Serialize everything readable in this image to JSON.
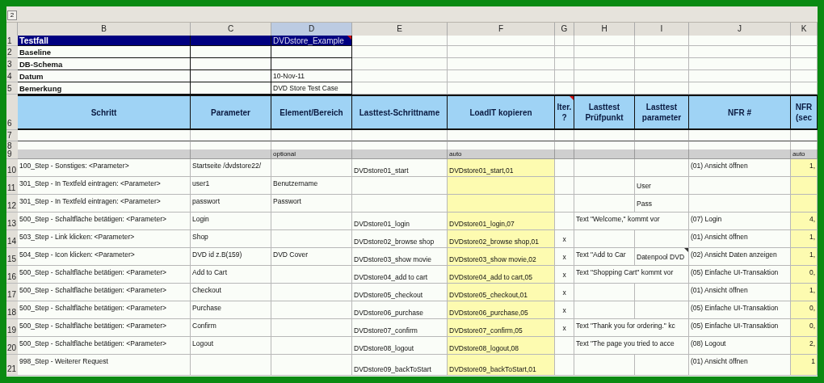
{
  "outline": {
    "level_button": "2"
  },
  "columns": [
    {
      "letter": "B",
      "selected": false
    },
    {
      "letter": "C",
      "selected": false
    },
    {
      "letter": "D",
      "selected": true
    },
    {
      "letter": "E",
      "selected": false
    },
    {
      "letter": "F",
      "selected": false
    },
    {
      "letter": "G",
      "selected": false
    },
    {
      "letter": "H",
      "selected": false
    },
    {
      "letter": "I",
      "selected": false
    },
    {
      "letter": "J",
      "selected": false
    },
    {
      "letter": "K",
      "selected": false
    }
  ],
  "meta": [
    {
      "row": "1",
      "kind": "title",
      "label": "Testfall",
      "value": "DVDstore_Example",
      "comment": true
    },
    {
      "row": "2",
      "kind": "field",
      "label": "Baseline",
      "comment": false
    },
    {
      "row": "3",
      "kind": "field",
      "label": "DB-Schema",
      "comment": false
    },
    {
      "row": "4",
      "kind": "field",
      "label": "Datum",
      "value": "10-Nov-11",
      "comment": false
    },
    {
      "row": "5",
      "kind": "field",
      "label": "Bemerkung",
      "value": "DVD Store Test Case",
      "comment": false
    }
  ],
  "header": {
    "row": "6",
    "labels": [
      {
        "text": "Schritt",
        "comment": false
      },
      {
        "text": "Parameter",
        "comment": false
      },
      {
        "text": "Element/Bereich",
        "comment": false
      },
      {
        "text": "Lasttest-Schrittname",
        "comment": false
      },
      {
        "text": "LoadIT kopieren",
        "comment": false
      },
      {
        "text": "Iter. ?",
        "comment": true
      },
      {
        "text": "Lasttest Prüfpunkt",
        "comment": false
      },
      {
        "text": "Lasttest parameter",
        "comment": false
      },
      {
        "text": "NFR #",
        "comment": false
      },
      {
        "text": "NFR (sec",
        "comment": false
      }
    ]
  },
  "blank_rows": [
    "7",
    "8"
  ],
  "hint_row": {
    "row": "9",
    "element": "optional",
    "loadit": "auto",
    "sec": "auto"
  },
  "steps": [
    {
      "row": "10",
      "schritt": "100_Step - Sonstiges: <Parameter>",
      "parameter": "Startseite /dvdstore22/",
      "name": "DVDstore01_start",
      "loadit": "DVDstore01_start,01",
      "nfr": "(01) Ansicht öffnen",
      "sec": "1,",
      "param_comment": false
    },
    {
      "row": "11",
      "schritt": "301_Step - In Textfeld eintragen: <Parameter>",
      "parameter": "user1",
      "element": "Benutzername",
      "param": "User",
      "param_comment": false
    },
    {
      "row": "12",
      "schritt": "301_Step - In Textfeld eintragen: <Parameter>",
      "parameter": "passwort",
      "element": "Passwort",
      "param": "Pass",
      "param_comment": false
    },
    {
      "row": "13",
      "schritt": "500_Step - Schaltfläche betätigen: <Parameter>",
      "parameter": "Login",
      "name": "DVDstore01_login",
      "loadit": "DVDstore01_login,07",
      "pruefpunkt": "Text \"Welcome,\" kommt vor",
      "nfr": "(07) Login",
      "sec": "4,",
      "param_comment": false
    },
    {
      "row": "14",
      "schritt": "503_Step - Link klicken: <Parameter>",
      "parameter": "Shop",
      "name": "DVDstore02_browse shop",
      "loadit": "DVDstore02_browse shop,01",
      "iter": "x",
      "nfr": "(01) Ansicht öffnen",
      "sec": "1,",
      "param_comment": false
    },
    {
      "row": "15",
      "schritt": "504_Step - Icon klicken: <Parameter>",
      "parameter": "DVD id z.B(159)",
      "element": "DVD Cover",
      "name": "DVDstore03_show movie",
      "loadit": "DVDstore03_show movie,02",
      "iter": "x",
      "pruefpunkt": "Text \"Add to Car",
      "param": "Datenpool DVD",
      "nfr": "(02) Ansicht Daten anzeigen",
      "sec": "1,",
      "param_comment": true
    },
    {
      "row": "16",
      "schritt": "500_Step - Schaltfläche betätigen: <Parameter>",
      "parameter": "Add to Cart",
      "name": "DVDstore04_add to cart",
      "loadit": "DVDstore04_add to cart,05",
      "iter": "x",
      "pruefpunkt": "Text \"Shopping Cart\" kommt vor",
      "nfr": "(05) Einfache UI-Transaktion",
      "sec": "0,",
      "param_comment": false
    },
    {
      "row": "17",
      "schritt": "500_Step - Schaltfläche betätigen: <Parameter>",
      "parameter": "Checkout",
      "name": "DVDstore05_checkout",
      "loadit": "DVDstore05_checkout,01",
      "iter": "x",
      "nfr": "(01) Ansicht öffnen",
      "sec": "1,",
      "param_comment": false
    },
    {
      "row": "18",
      "schritt": "500_Step - Schaltfläche betätigen: <Parameter>",
      "parameter": "Purchase",
      "name": "DVDstore06_purchase",
      "loadit": "DVDstore06_purchase,05",
      "iter": "x",
      "nfr": "(05) Einfache UI-Transaktion",
      "sec": "0,",
      "param_comment": false
    },
    {
      "row": "19",
      "schritt": "500_Step - Schaltfläche betätigen: <Parameter>",
      "parameter": "Confirm",
      "name": "DVDstore07_confirm",
      "loadit": "DVDstore07_confirm,05",
      "iter": "x",
      "pruefpunkt": "Text \"Thank you for ordering.\" kc",
      "nfr": "(05) Einfache UI-Transaktion",
      "sec": "0,",
      "param_comment": false
    },
    {
      "row": "20",
      "schritt": "500_Step - Schaltfläche betätigen: <Parameter>",
      "parameter": "Logout",
      "name": "DVDstore08_logout",
      "loadit": "DVDstore08_logout,08",
      "pruefpunkt": "Text \"The page you tried to acce",
      "nfr": "(08) Logout",
      "sec": "2,",
      "param_comment": false
    },
    {
      "row": "21",
      "schritt": "998_Step - Weiterer Request",
      "name": "DVDstore09_backToStart",
      "loadit": "DVDstore09_backToStart,01",
      "nfr": "(01) Ansicht öffnen",
      "sec": "1",
      "param_comment": false
    }
  ]
}
